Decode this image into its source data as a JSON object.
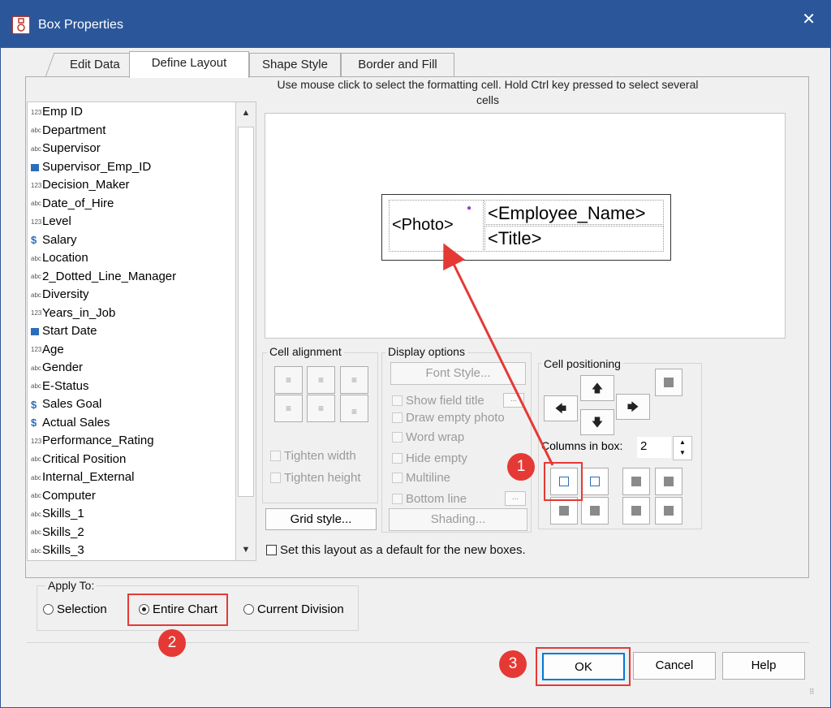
{
  "window": {
    "title": "Box Properties",
    "close_icon": "close-icon",
    "title_icon": "org-chart-icon"
  },
  "tabs": [
    "Edit Data",
    "Define Layout",
    "Shape Style",
    "Border and Fill"
  ],
  "active_tab": "Define Layout",
  "fields": [
    {
      "type": "123",
      "label": "Emp ID"
    },
    {
      "type": "abc",
      "label": "Department"
    },
    {
      "type": "abc",
      "label": "Supervisor"
    },
    {
      "type": "ref",
      "label": "Supervisor_Emp_ID"
    },
    {
      "type": "123",
      "label": "Decision_Maker"
    },
    {
      "type": "abc",
      "label": "Date_of_Hire"
    },
    {
      "type": "123",
      "label": "Level"
    },
    {
      "type": "$",
      "label": "Salary"
    },
    {
      "type": "abc",
      "label": "Location"
    },
    {
      "type": "abc",
      "label": "2_Dotted_Line_Manager"
    },
    {
      "type": "abc",
      "label": "Diversity"
    },
    {
      "type": "123",
      "label": "Years_in_Job"
    },
    {
      "type": "date",
      "label": "Start Date"
    },
    {
      "type": "123",
      "label": "Age"
    },
    {
      "type": "abc",
      "label": "Gender"
    },
    {
      "type": "abc",
      "label": "E-Status"
    },
    {
      "type": "$",
      "label": "Sales Goal"
    },
    {
      "type": "$",
      "label": "Actual Sales"
    },
    {
      "type": "123",
      "label": "Performance_Rating"
    },
    {
      "type": "abc",
      "label": "Critical Position"
    },
    {
      "type": "abc",
      "label": "Internal_External"
    },
    {
      "type": "abc",
      "label": "Computer"
    },
    {
      "type": "abc",
      "label": "Skills_1"
    },
    {
      "type": "abc",
      "label": "Skills_2"
    },
    {
      "type": "abc",
      "label": "Skills_3"
    }
  ],
  "instruction": "Use mouse click to select the formatting cell. Hold Ctrl key pressed to select several cells",
  "layout_cells": {
    "photo": "<Photo>",
    "name": "<Employee_Name>",
    "title": "<Title>"
  },
  "cell_alignment": {
    "label": "Cell alignment",
    "tighten_width": "Tighten width",
    "tighten_height": "Tighten height"
  },
  "display_options": {
    "label": "Display options",
    "font_style": "Font Style...",
    "show_field_title": "Show field title",
    "draw_empty_photo": "Draw empty photo",
    "word_wrap": "Word wrap",
    "hide_empty": "Hide empty",
    "multiline": "Multiline",
    "bottom_line": "Bottom line",
    "shading": "Shading...",
    "ellipsis": "..."
  },
  "cell_positioning": {
    "label": "Cell positioning",
    "columns_label": "Columns in box:",
    "columns_value": "2"
  },
  "grid_style": "Grid style...",
  "default_checkbox": "Set this layout as a default for the new boxes.",
  "apply_to": {
    "label": "Apply To:",
    "options": [
      "Selection",
      "Entire Chart",
      "Current Division"
    ],
    "selected": "Entire Chart"
  },
  "buttons": {
    "ok": "OK",
    "cancel": "Cancel",
    "help": "Help"
  },
  "callouts": [
    "1",
    "2",
    "3"
  ],
  "colors": {
    "titlebar": "#2b579a",
    "highlight": "#e53935"
  }
}
